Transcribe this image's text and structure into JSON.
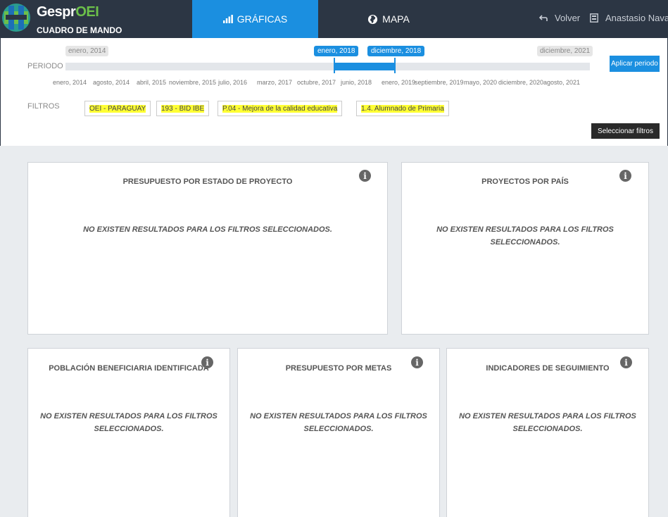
{
  "app": {
    "brand_prefix": "Gespr",
    "brand_suffix": "OEI",
    "subtitle": "CUADRO DE MANDO"
  },
  "nav": {
    "graficas": "GRÁFICAS",
    "mapa": "MAPA",
    "back": "Volver",
    "user": "Anastasio Nava"
  },
  "period": {
    "label": "PERIODO",
    "min": "enero, 2014",
    "max": "diciembre, 2021",
    "selected_start": "enero, 2018",
    "selected_end": "diciembre, 2018",
    "ticks": [
      "enero, 2014",
      "agosto, 2014",
      "abril, 2015",
      "noviembre, 2015",
      "julio, 2016",
      "marzo, 2017",
      "octubre, 2017",
      "junio, 2018",
      "enero, 2019",
      "septiembre, 2019",
      "mayo, 2020",
      "diciembre, 2020",
      "agosto, 2021"
    ],
    "apply_button": "Aplicar periodo"
  },
  "filters": {
    "label": "FILTROS",
    "chips": [
      "OEI - PARAGUAY",
      "193 - BID IBE",
      "P.04 - Mejora de la calidad educativa",
      "1.4. Alumnado de Primaria"
    ],
    "select_button": "Seleccionar filtros"
  },
  "cards": {
    "presupuesto_estado": "PRESUPUESTO POR ESTADO DE PROYECTO",
    "proyectos_pais": "PROYECTOS POR PAÍS",
    "poblacion": "POBLACIÓN BENEFICIARIA IDENTIFICADA",
    "presupuesto_metas": "PRESUPUESTO POR METAS",
    "indicadores": "INDICADORES DE SEGUIMIENTO",
    "no_results_1": "NO EXISTEN RESULTADOS PARA LOS FILTROS SELECCIONADOS.",
    "no_results_2a": "NO EXISTEN RESULTADOS PARA LOS FILTROS",
    "no_results_2b": "SELECCIONADOS."
  },
  "colors": {
    "topbar": "#2c3644",
    "accent": "#1b8fe0",
    "highlight": "#ffff33"
  }
}
